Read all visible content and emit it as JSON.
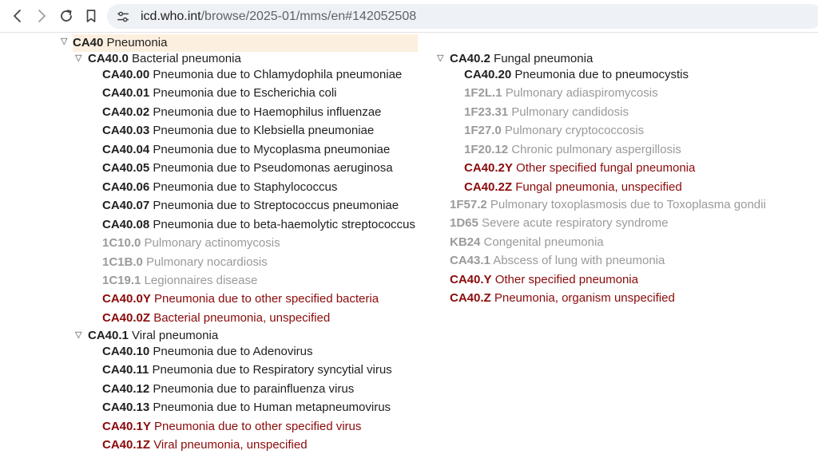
{
  "browser": {
    "url_host": "icd.who.int",
    "url_path": "/browse/2025-01/mms/en#142052508",
    "back_icon": "arrow-left-icon",
    "forward_icon": "arrow-right-icon",
    "reload_icon": "reload-icon",
    "bookmark_icon": "bookmark-icon",
    "site_info_icon": "tune-icon"
  },
  "toggle_glyph": "▽",
  "tree": {
    "root": {
      "code": "CA40",
      "name": "Pneumonia"
    },
    "bacterial": {
      "header": {
        "code": "CA40.0",
        "name": "Bacterial pneumonia"
      },
      "children": [
        {
          "code": "CA40.00",
          "name": "Pneumonia due to Chlamydophila pneumoniae",
          "style": "normal"
        },
        {
          "code": "CA40.01",
          "name": "Pneumonia due to Escherichia coli",
          "style": "normal"
        },
        {
          "code": "CA40.02",
          "name": "Pneumonia due to Haemophilus influenzae",
          "style": "normal"
        },
        {
          "code": "CA40.03",
          "name": "Pneumonia due to Klebsiella pneumoniae",
          "style": "normal"
        },
        {
          "code": "CA40.04",
          "name": "Pneumonia due to Mycoplasma pneumoniae",
          "style": "normal"
        },
        {
          "code": "CA40.05",
          "name": "Pneumonia due to Pseudomonas aeruginosa",
          "style": "normal"
        },
        {
          "code": "CA40.06",
          "name": "Pneumonia due to Staphylococcus",
          "style": "normal"
        },
        {
          "code": "CA40.07",
          "name": "Pneumonia due to Streptococcus pneumoniae",
          "style": "normal"
        },
        {
          "code": "CA40.08",
          "name": "Pneumonia due to beta-haemolytic streptococcus",
          "style": "normal"
        },
        {
          "code": "1C10.0",
          "name": "Pulmonary actinomycosis",
          "style": "grey"
        },
        {
          "code": "1C1B.0",
          "name": "Pulmonary nocardiosis",
          "style": "grey"
        },
        {
          "code": "1C19.1",
          "name": "Legionnaires disease",
          "style": "grey"
        },
        {
          "code": "CA40.0Y",
          "name": "Pneumonia due to other specified bacteria",
          "style": "red"
        },
        {
          "code": "CA40.0Z",
          "name": "Bacterial pneumonia, unspecified",
          "style": "red"
        }
      ]
    },
    "viral": {
      "header": {
        "code": "CA40.1",
        "name": "Viral pneumonia"
      },
      "children": [
        {
          "code": "CA40.10",
          "name": "Pneumonia due to Adenovirus",
          "style": "normal"
        },
        {
          "code": "CA40.11",
          "name": "Pneumonia due to Respiratory syncytial virus",
          "style": "normal"
        },
        {
          "code": "CA40.12",
          "name": "Pneumonia due to parainfluenza virus",
          "style": "normal"
        },
        {
          "code": "CA40.13",
          "name": "Pneumonia due to Human metapneumovirus",
          "style": "normal"
        },
        {
          "code": "CA40.1Y",
          "name": "Pneumonia due to other specified virus",
          "style": "red"
        },
        {
          "code": "CA40.1Z",
          "name": "Viral pneumonia, unspecified",
          "style": "red"
        }
      ]
    },
    "fungal": {
      "header": {
        "code": "CA40.2",
        "name": "Fungal pneumonia"
      },
      "children": [
        {
          "code": "CA40.20",
          "name": "Pneumonia due to pneumocystis",
          "style": "normal"
        },
        {
          "code": "1F2L.1",
          "name": "Pulmonary adiaspiromycosis",
          "style": "grey"
        },
        {
          "code": "1F23.31",
          "name": "Pulmonary candidosis",
          "style": "grey"
        },
        {
          "code": "1F27.0",
          "name": "Pulmonary cryptococcosis",
          "style": "grey"
        },
        {
          "code": "1F20.12",
          "name": "Chronic pulmonary aspergillosis",
          "style": "grey"
        },
        {
          "code": "CA40.2Y",
          "name": "Other specified fungal pneumonia",
          "style": "red"
        },
        {
          "code": "CA40.2Z",
          "name": "Fungal pneumonia, unspecified",
          "style": "red"
        }
      ]
    },
    "others": [
      {
        "code": "1F57.2",
        "name": "Pulmonary toxoplasmosis due to Toxoplasma gondii",
        "style": "grey"
      },
      {
        "code": "1D65",
        "name": "Severe acute respiratory syndrome",
        "style": "grey"
      },
      {
        "code": "KB24",
        "name": "Congenital pneumonia",
        "style": "grey"
      },
      {
        "code": "CA43.1",
        "name": "Abscess of lung with pneumonia",
        "style": "grey"
      },
      {
        "code": "CA40.Y",
        "name": "Other specified pneumonia",
        "style": "red"
      },
      {
        "code": "CA40.Z",
        "name": "Pneumonia, organism unspecified",
        "style": "red"
      }
    ]
  },
  "colors": {
    "red": "#8b0a0a",
    "grey": "#9a9a9a",
    "highlight": "#fdefdf"
  }
}
